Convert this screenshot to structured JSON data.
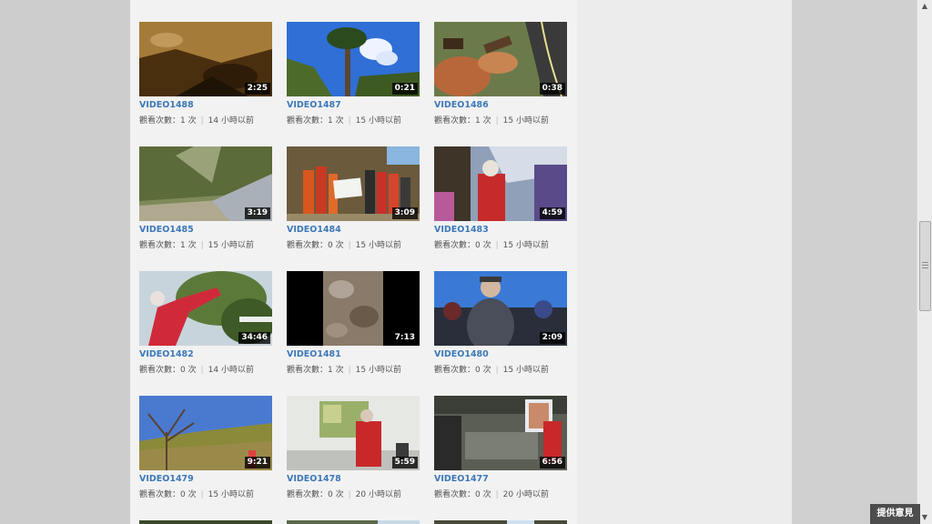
{
  "videos": [
    {
      "title": "VIDEO1488",
      "duration": "2:25",
      "views": "觀看次數：1 次",
      "time": "14 小時以前"
    },
    {
      "title": "VIDEO1487",
      "duration": "0:21",
      "views": "觀看次數：1 次",
      "time": "15 小時以前"
    },
    {
      "title": "VIDEO1486",
      "duration": "0:38",
      "views": "觀看次數：1 次",
      "time": "15 小時以前"
    },
    {
      "title": "VIDEO1485",
      "duration": "3:19",
      "views": "觀看次數：1 次",
      "time": "15 小時以前"
    },
    {
      "title": "VIDEO1484",
      "duration": "3:09",
      "views": "觀看次數：0 次",
      "time": "15 小時以前"
    },
    {
      "title": "VIDEO1483",
      "duration": "4:59",
      "views": "觀看次數：0 次",
      "time": "15 小時以前"
    },
    {
      "title": "VIDEO1482",
      "duration": "34:46",
      "views": "觀看次數：0 次",
      "time": "14 小時以前"
    },
    {
      "title": "VIDEO1481",
      "duration": "7:13",
      "views": "觀看次數：1 次",
      "time": "15 小時以前"
    },
    {
      "title": "VIDEO1480",
      "duration": "2:09",
      "views": "觀看次數：0 次",
      "time": "15 小時以前"
    },
    {
      "title": "VIDEO1479",
      "duration": "9:21",
      "views": "觀看次數：0 次",
      "time": "15 小時以前"
    },
    {
      "title": "VIDEO1478",
      "duration": "5:59",
      "views": "觀看次數：0 次",
      "time": "20 小時以前"
    },
    {
      "title": "VIDEO1477",
      "duration": "6:56",
      "views": "觀看次數：0 次",
      "time": "20 小時以前"
    }
  ],
  "feedback": {
    "label": "提供意見"
  },
  "colors": {
    "link": "#3d78b8",
    "content_bg": "#f2f2f2"
  }
}
